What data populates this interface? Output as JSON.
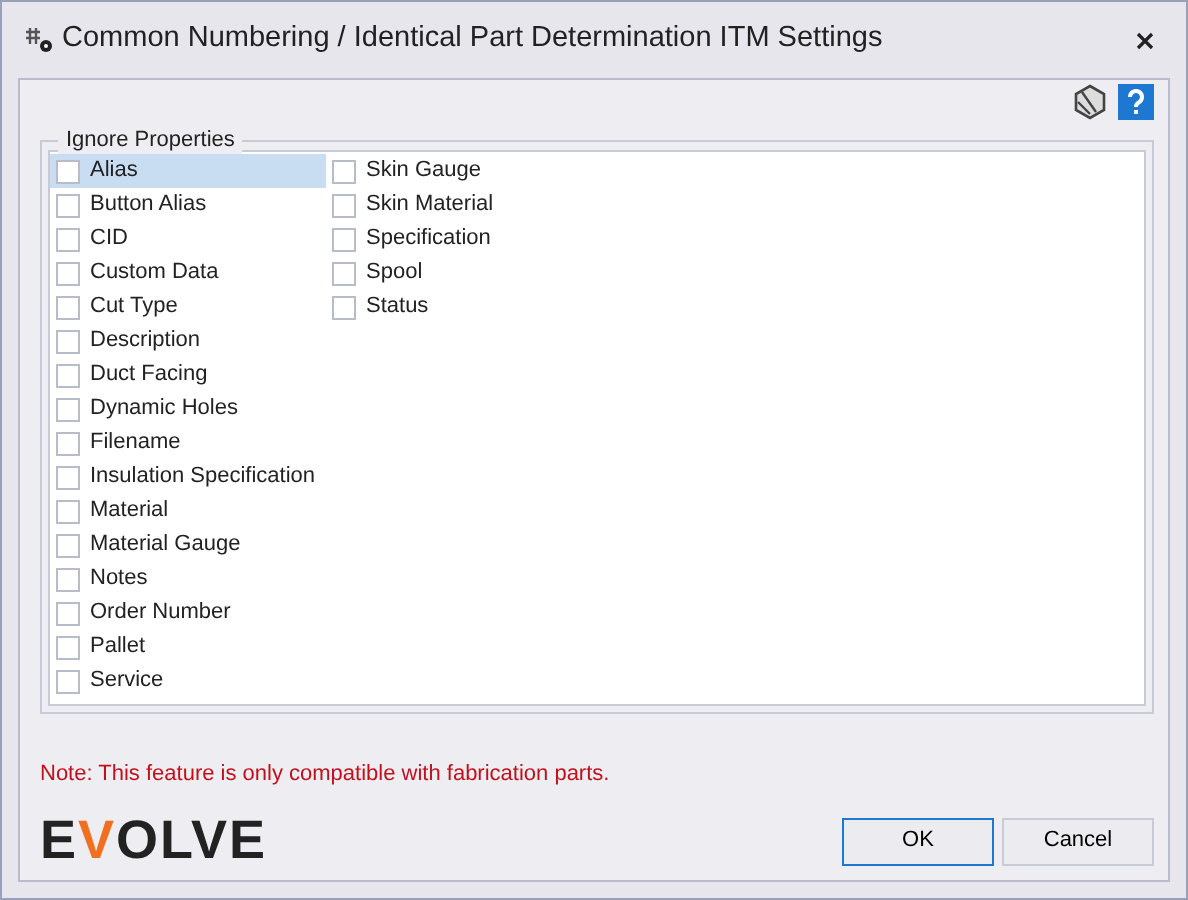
{
  "window": {
    "title": "Common Numbering / Identical Part Determination ITM Settings"
  },
  "group": {
    "title": "Ignore Properties",
    "items": [
      {
        "label": "Alias",
        "checked": false,
        "selected": true
      },
      {
        "label": "Button Alias",
        "checked": false,
        "selected": false
      },
      {
        "label": "CID",
        "checked": false,
        "selected": false
      },
      {
        "label": "Custom Data",
        "checked": false,
        "selected": false
      },
      {
        "label": "Cut Type",
        "checked": false,
        "selected": false
      },
      {
        "label": "Description",
        "checked": false,
        "selected": false
      },
      {
        "label": "Duct Facing",
        "checked": false,
        "selected": false
      },
      {
        "label": "Dynamic Holes",
        "checked": false,
        "selected": false
      },
      {
        "label": "Filename",
        "checked": false,
        "selected": false
      },
      {
        "label": "Insulation Specification",
        "checked": false,
        "selected": false
      },
      {
        "label": "Material",
        "checked": false,
        "selected": false
      },
      {
        "label": "Material Gauge",
        "checked": false,
        "selected": false
      },
      {
        "label": "Notes",
        "checked": false,
        "selected": false
      },
      {
        "label": "Order Number",
        "checked": false,
        "selected": false
      },
      {
        "label": "Pallet",
        "checked": false,
        "selected": false
      },
      {
        "label": "Service",
        "checked": false,
        "selected": false
      },
      {
        "label": "Skin Gauge",
        "checked": false,
        "selected": false
      },
      {
        "label": "Skin Material",
        "checked": false,
        "selected": false
      },
      {
        "label": "Specification",
        "checked": false,
        "selected": false
      },
      {
        "label": "Spool",
        "checked": false,
        "selected": false
      },
      {
        "label": "Status",
        "checked": false,
        "selected": false
      }
    ]
  },
  "note": "Note: This feature is only compatible with fabrication parts.",
  "logo": {
    "before": "E",
    "accent": "V",
    "after": "OLVE"
  },
  "buttons": [
    {
      "label": "OK",
      "kind": "default"
    },
    {
      "label": "Cancel",
      "kind": "normal"
    }
  ]
}
